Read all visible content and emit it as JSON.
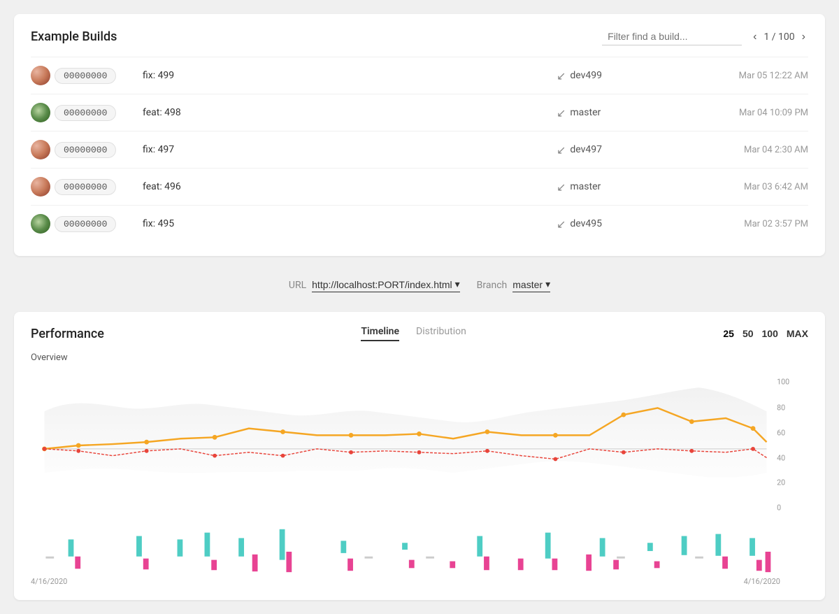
{
  "builds": {
    "title": "Example Builds",
    "filter_placeholder": "Filter find a build...",
    "pagination": {
      "current": 1,
      "total": 100,
      "label": "1 / 100"
    },
    "rows": [
      {
        "id": "build-1",
        "hash": "00000000",
        "message": "fix: 499",
        "branch": "dev499",
        "date": "Mar 05 12:22 AM",
        "avatar_class": "avatar-1"
      },
      {
        "id": "build-2",
        "hash": "00000000",
        "message": "feat: 498",
        "branch": "master",
        "date": "Mar 04 10:09 PM",
        "avatar_class": "avatar-2"
      },
      {
        "id": "build-3",
        "hash": "00000000",
        "message": "fix: 497",
        "branch": "dev497",
        "date": "Mar 04 2:30 AM",
        "avatar_class": "avatar-3"
      },
      {
        "id": "build-4",
        "hash": "00000000",
        "message": "feat: 496",
        "branch": "master",
        "date": "Mar 03 6:42 AM",
        "avatar_class": "avatar-4"
      },
      {
        "id": "build-5",
        "hash": "00000000",
        "message": "fix: 495",
        "branch": "dev495",
        "date": "Mar 02 3:57 PM",
        "avatar_class": "avatar-5"
      }
    ]
  },
  "controls": {
    "url_label": "URL",
    "url_value": "http://localhost:PORT/index.html",
    "branch_label": "Branch",
    "branch_value": "master"
  },
  "performance": {
    "title": "Performance",
    "tabs": [
      {
        "id": "timeline",
        "label": "Timeline",
        "active": true
      },
      {
        "id": "distribution",
        "label": "Distribution",
        "active": false
      }
    ],
    "counts": [
      "25",
      "50",
      "100",
      "MAX"
    ],
    "overview_label": "Overview",
    "y_axis": [
      "100",
      "80",
      "60",
      "40",
      "20",
      "0"
    ],
    "x_axis_start": "4/16/2020",
    "x_axis_end": "4/16/2020"
  }
}
